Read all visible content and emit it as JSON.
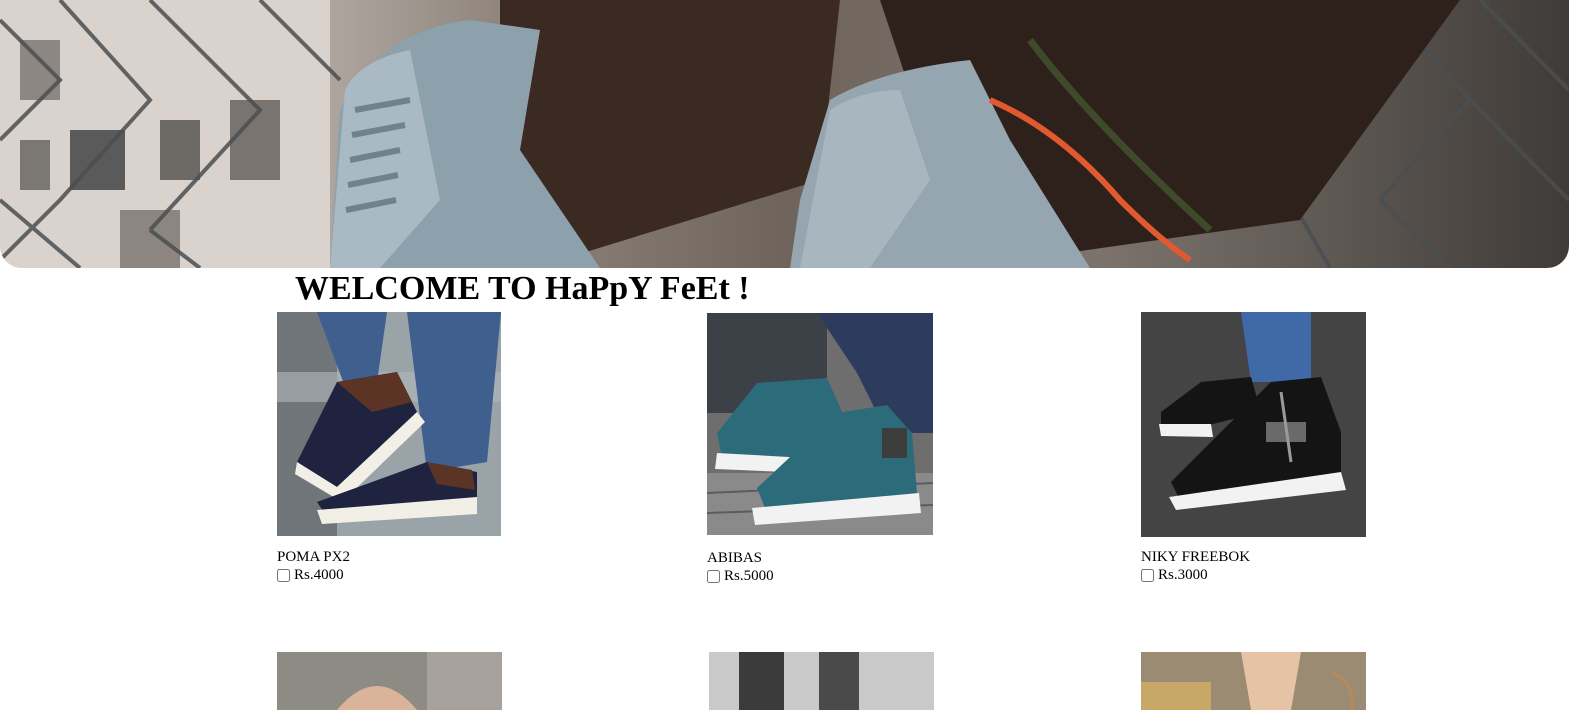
{
  "page": {
    "title": "WELCOME TO HaPpY FeEt !"
  },
  "products": [
    {
      "name": "POMA PX2",
      "price": "Rs.4000",
      "selected": false
    },
    {
      "name": "ABIBAS",
      "price": "Rs.5000",
      "selected": false
    },
    {
      "name": "NIKY FREEBOK",
      "price": "Rs.3000",
      "selected": false
    }
  ],
  "colors": {
    "shoe_navy": "#1f2340",
    "shoe_teal": "#2c6b79",
    "shoe_black": "#141414",
    "sole_white": "#f2f2f2",
    "denim": "#3f5f8f"
  }
}
